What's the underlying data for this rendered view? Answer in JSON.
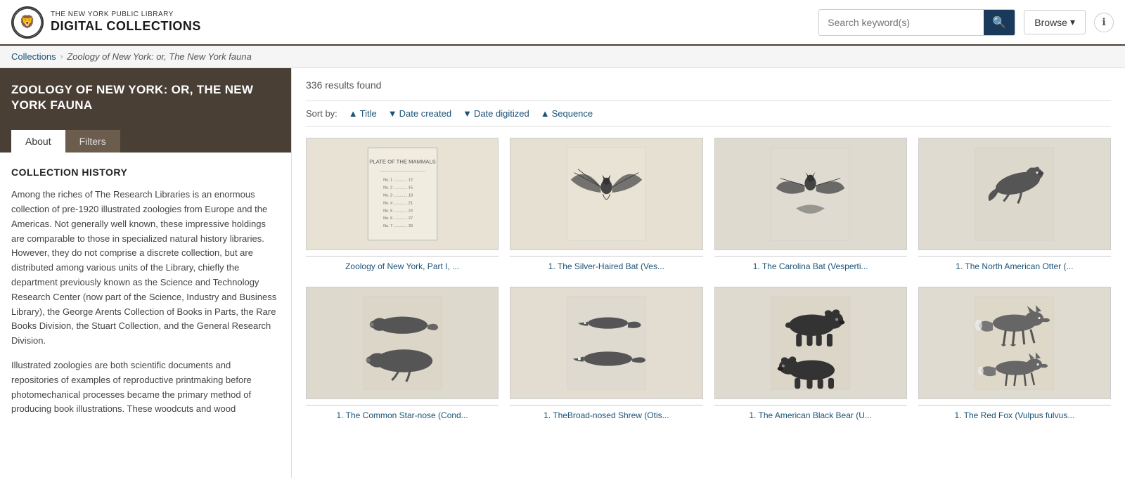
{
  "header": {
    "logo_small": "THE NEW YORK PUBLIC LIBRARY",
    "logo_big": "DIGITAL COLLECTIONS",
    "search_placeholder": "Search keyword(s)",
    "browse_label": "Browse",
    "info_icon": "ℹ"
  },
  "breadcrumb": {
    "collections_label": "Collections",
    "separator": "›",
    "current_page": "Zoology of New York: or, The New York fauna"
  },
  "sidebar": {
    "title": "ZOOLOGY OF NEW YORK: OR, THE NEW YORK FAUNA",
    "tab_about": "About",
    "tab_filters": "Filters",
    "section_title": "COLLECTION HISTORY",
    "paragraph1": "Among the riches of The Research Libraries is an enormous collection of pre-1920 illustrated zoologies from Europe and the Americas. Not generally well known, these impressive holdings are comparable to those in specialized natural history libraries. However, they do not comprise a discrete collection, but are distributed among various units of the Library, chiefly the department previously known as the Science and Technology Research Center (now part of the Science, Industry and Business Library), the George Arents Collection of Books in Parts, the Rare Books Division, the Stuart Collection, and the General Research Division.",
    "paragraph2": "Illustrated zoologies are both scientific documents and repositories of examples of reproductive printmaking before photomechanical processes became the primary method of producing book illustrations. These woodcuts and wood"
  },
  "content": {
    "results_count": "336 results found",
    "sort_label": "Sort by:",
    "sort_options": [
      {
        "label": "Title",
        "arrow": "▲"
      },
      {
        "label": "Date created",
        "arrow": "▼"
      },
      {
        "label": "Date digitized",
        "arrow": "▼"
      },
      {
        "label": "Sequence",
        "arrow": "▲"
      }
    ],
    "items": [
      {
        "title": "Zoology of New York, Part I, ...",
        "type": "text_page",
        "bg": "#e8e2d4"
      },
      {
        "title": "1. The Silver-Haired Bat (Ves...",
        "type": "bat_spread",
        "bg": "#e5e0d2"
      },
      {
        "title": "1. The Carolina Bat (Vesperti...",
        "type": "bat_folded",
        "bg": "#dedad0"
      },
      {
        "title": "1. The North American Otter (...",
        "type": "otter",
        "bg": "#e0dbd0"
      },
      {
        "title": "1. The Common Star-nose (Cond...",
        "type": "mole",
        "bg": "#ddd9cc"
      },
      {
        "title": "1. TheBroad-nosed Shrew (Otis...",
        "type": "shrew",
        "bg": "#e2ddd0"
      },
      {
        "title": "1. The American Black Bear (U...",
        "type": "bear",
        "bg": "#dedad0"
      },
      {
        "title": "1. The Red Fox (Vulpus fulvus...",
        "type": "fox",
        "bg": "#e0dbd0"
      }
    ]
  }
}
